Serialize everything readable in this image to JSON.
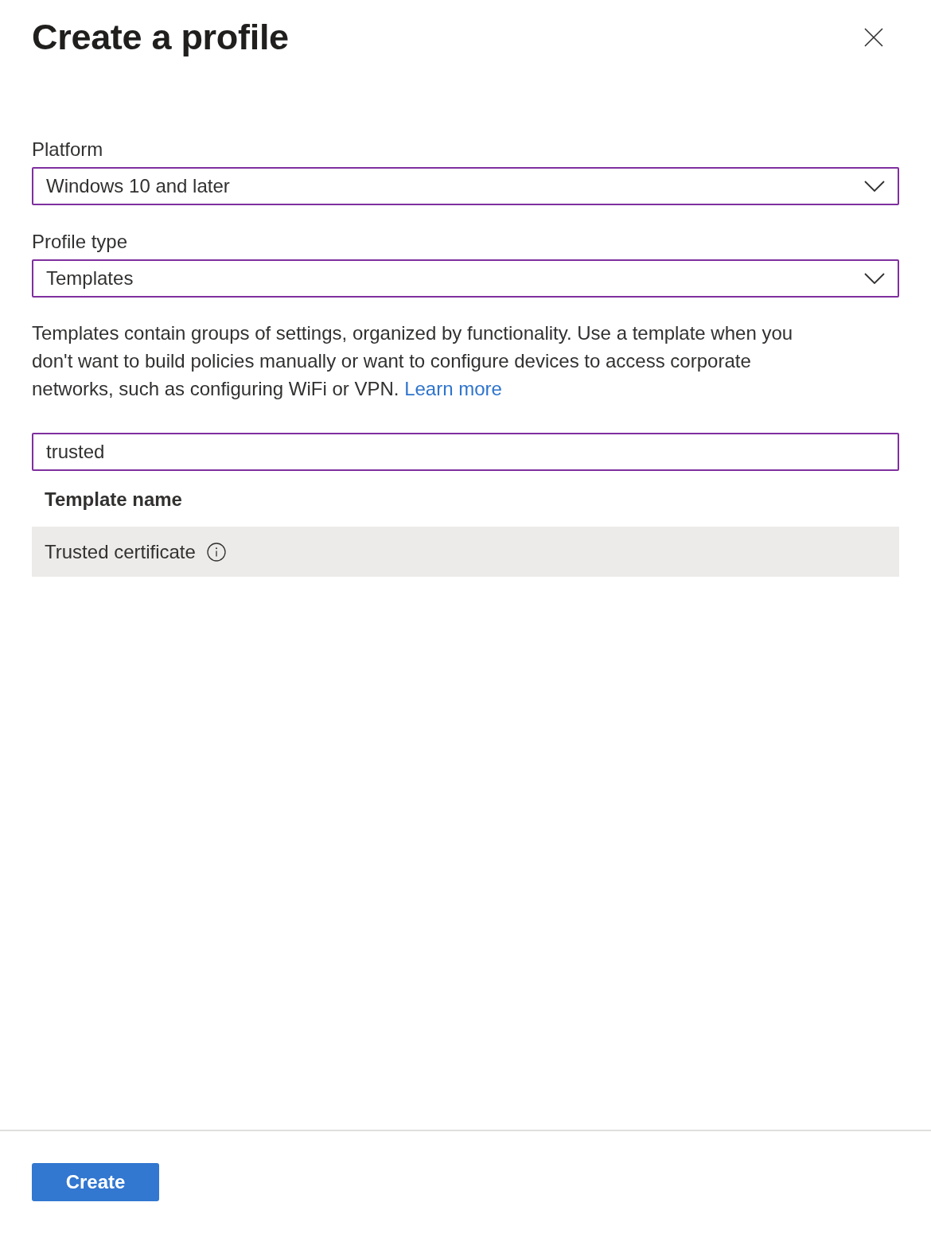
{
  "panel": {
    "title": "Create a profile"
  },
  "fields": [
    {
      "label": "Platform",
      "value": "Windows 10 and later"
    },
    {
      "label": "Profile type",
      "value": "Templates"
    }
  ],
  "description": {
    "text": "Templates contain groups of settings, organized by functionality. Use a template when you don't want to build policies manually or want to configure devices to access corporate networks, such as configuring WiFi or VPN.",
    "link": "Learn more"
  },
  "search": {
    "value": "trusted"
  },
  "table": {
    "columns": [
      "Template name"
    ],
    "rows": [
      {
        "name": "Trusted certificate",
        "selected": true
      }
    ]
  },
  "footer": {
    "button": "Create"
  }
}
